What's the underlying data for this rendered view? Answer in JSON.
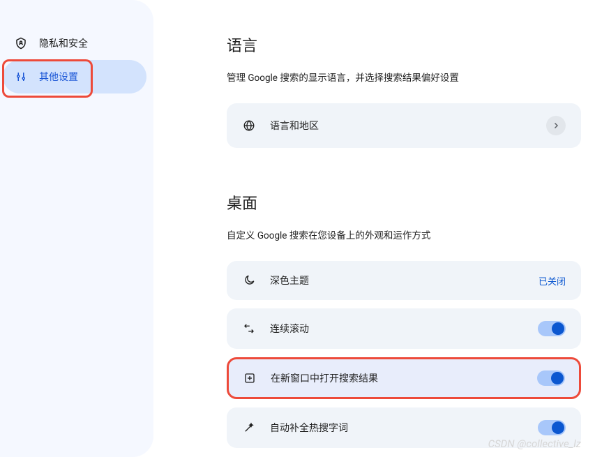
{
  "sidebar": {
    "items": [
      {
        "label": "隐私和安全"
      },
      {
        "label": "其他设置"
      }
    ]
  },
  "sections": {
    "language": {
      "title": "语言",
      "desc": "管理 Google 搜索的显示语言，并选择搜索结果偏好设置",
      "item_label": "语言和地区"
    },
    "desktop": {
      "title": "桌面",
      "desc": "自定义 Google 搜索在您设备上的外观和运作方式",
      "items": [
        {
          "label": "深色主题",
          "status": "已关闭"
        },
        {
          "label": "连续滚动"
        },
        {
          "label": "在新窗口中打开搜索结果"
        },
        {
          "label": "自动补全热搜字词"
        }
      ]
    }
  },
  "watermark": "CSDN @collective_lz"
}
